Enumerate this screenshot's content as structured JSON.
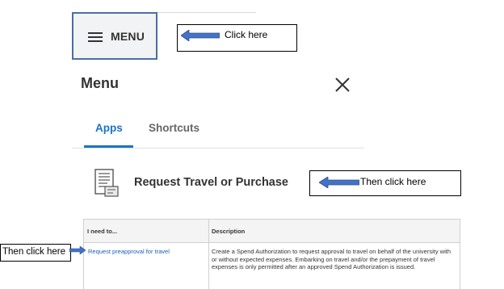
{
  "menu_button": {
    "label": "MENU"
  },
  "callouts": {
    "first": "Click here",
    "second": "Then click here",
    "third": "Then click here"
  },
  "panel": {
    "title": "Menu",
    "tabs": [
      {
        "label": "Apps",
        "active": true
      },
      {
        "label": "Shortcuts",
        "active": false
      }
    ],
    "app": {
      "label": "Request Travel or Purchase",
      "icon": "document-form-icon"
    }
  },
  "table": {
    "headers": [
      "I need to...",
      "Description"
    ],
    "rows": [
      {
        "action": "Request preapproval for travel",
        "description": "Create a Spend Authorization to request approval to travel on behalf of the university with or without expected expenses. Embarking on travel and/or the prepayment of travel expenses is only permitted after an approved Spend Authorization is issued."
      }
    ]
  },
  "colors": {
    "accent": "#1a73c8",
    "arrow": "#4472c4",
    "button_border": "#4a6fa5"
  }
}
